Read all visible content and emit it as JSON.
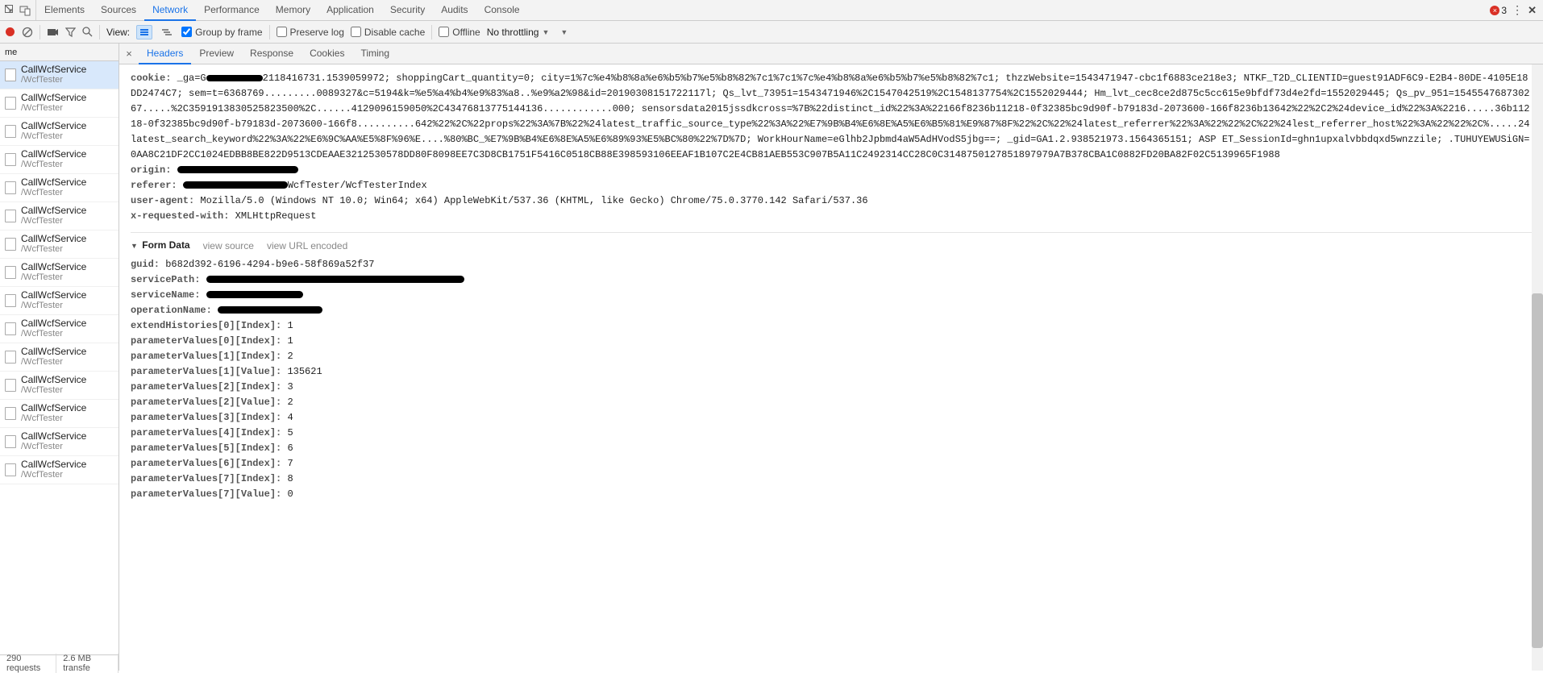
{
  "tabstrip": {
    "tabs": [
      {
        "label": "Elements",
        "selected": false
      },
      {
        "label": "Sources",
        "selected": false
      },
      {
        "label": "Network",
        "selected": true
      },
      {
        "label": "Performance",
        "selected": false
      },
      {
        "label": "Memory",
        "selected": false
      },
      {
        "label": "Application",
        "selected": false
      },
      {
        "label": "Security",
        "selected": false
      },
      {
        "label": "Audits",
        "selected": false
      },
      {
        "label": "Console",
        "selected": false
      }
    ],
    "errors": "3"
  },
  "toolbar": {
    "view_label": "View:",
    "group_by_frame": "Group by frame",
    "preserve_log": "Preserve log",
    "disable_cache": "Disable cache",
    "offline": "Offline",
    "throttling": "No throttling"
  },
  "left": {
    "header": "me",
    "item_l1": "CallWcfService",
    "item_l2": "/WcfTester",
    "count": 15,
    "selected_index": 0,
    "status": {
      "requests": "290 requests",
      "transfer": "2.6 MB transfe"
    }
  },
  "subtabs": [
    {
      "label": "Headers",
      "selected": true
    },
    {
      "label": "Preview",
      "selected": false
    },
    {
      "label": "Response",
      "selected": false
    },
    {
      "label": "Cookies",
      "selected": false
    },
    {
      "label": "Timing",
      "selected": false
    }
  ],
  "headers": {
    "cookie_key": "cookie:",
    "cookie_prefix": "_ga=G",
    "cookie_body": "2118416731.1539059972; shoppingCart_quantity=0; city=1%7c%e4%b8%8a%e6%b5%b7%e5%b8%82%7c1%7c1%7c%e4%b8%8a%e6%b5%b7%e5%b8%82%7c1; thzzWebsite=1543471947-cbc1f6883ce218e3; NTKF_T2D_CLIENTID=guest91ADF6C9-E2B4-80DE-4105E18DD2474C7; sem=t=6368769.........0089327&c=5194&k=%e5%a4%b4%e9%83%a8..%e9%a2%98&id=20190308151722117l; Qs_lvt_73951=1543471946%2C1547042519%2C1548137754%2C1552029444; Hm_lvt_cec8ce2d875c5cc615e9bfdf73d4e2fd=1552029445; Qs_pv_951=154554768730267.....%2C3591913830525823500%2C......4129096159050%2C43476813775144136............000; sensorsdata2015jssdkcross=%7B%22distinct_id%22%3A%22166f8236b11218-0f32385bc9d90f-b79183d-2073600-166f8236b13642%22%2C2%24device_id%22%3A%2216.....36b11218-0f32385bc9d90f-b79183d-2073600-166f8..........642%22%2C%22props%22%3A%7B%22%24latest_traffic_source_type%22%3A%22%E7%9B%B4%E6%8E%A5%E6%B5%81%E9%87%8F%22%2C%22%24latest_referrer%22%3A%22%22%2C%22%24lest_referrer_host%22%3A%22%22%2C%.....24latest_search_keyword%22%3A%22%E6%9C%AA%E5%8F%96%E....%80%BC_%E7%9B%B4%E6%8E%A5%E6%89%93%E5%BC%80%22%7D%7D; WorkHourName=eGlhb2Jpbmd4aW5AdHVodS5jbg==; _gid=GA1.2.938521973.1564365151; ASP ET_SessionId=ghn1upxalvbbdqxd5wnzzile; .TUHUYEWUSiGN=0AA8C21DF2CC1024EDBB8BE822D9513CDEAAE3212530578DD80F8098EE7C3D8CB1751F5416C0518CB88E398593106EEAF1B107C2E4CB81AEB553C907B5A11C2492314CC28C0C3148750127851897979A7B378CBA1C0882FD20BA82F02C5139965F1988",
    "origin_key": "origin:",
    "referer_key": "referer:",
    "referer_suffix": "WcfTester/WcfTesterIndex",
    "ua_key": "user-agent:",
    "ua_val": "Mozilla/5.0 (Windows NT 10.0; Win64; x64) AppleWebKit/537.36 (KHTML, like Gecko) Chrome/75.0.3770.142 Safari/537.36",
    "xrw_key": "x-requested-with:",
    "xrw_val": "XMLHttpRequest"
  },
  "formdata": {
    "section_title": "Form Data",
    "view_source": "view source",
    "view_url": "view URL encoded",
    "rows": [
      {
        "k": "guid:",
        "v": "b682d392-6196-4294-b9e6-58f869a52f37",
        "redact": false
      },
      {
        "k": "servicePath:",
        "v": "",
        "redact": true,
        "rw": 320
      },
      {
        "k": "serviceName:",
        "v": "",
        "redact": true,
        "rw": 120
      },
      {
        "k": "operationName:",
        "v": "",
        "redact": true,
        "rw": 130
      },
      {
        "k": "extendHistories[0][Index]:",
        "v": "1",
        "redact": false
      },
      {
        "k": "parameterValues[0][Index]:",
        "v": "1",
        "redact": false
      },
      {
        "k": "parameterValues[1][Index]:",
        "v": "2",
        "redact": false
      },
      {
        "k": "parameterValues[1][Value]:",
        "v": "135621",
        "redact": false
      },
      {
        "k": "parameterValues[2][Index]:",
        "v": "3",
        "redact": false
      },
      {
        "k": "parameterValues[2][Value]:",
        "v": "2",
        "redact": false
      },
      {
        "k": "parameterValues[3][Index]:",
        "v": "4",
        "redact": false
      },
      {
        "k": "parameterValues[4][Index]:",
        "v": "5",
        "redact": false
      },
      {
        "k": "parameterValues[5][Index]:",
        "v": "6",
        "redact": false
      },
      {
        "k": "parameterValues[6][Index]:",
        "v": "7",
        "redact": false
      },
      {
        "k": "parameterValues[7][Index]:",
        "v": "8",
        "redact": false
      },
      {
        "k": "parameterValues[7][Value]:",
        "v": "0",
        "redact": false
      }
    ]
  }
}
